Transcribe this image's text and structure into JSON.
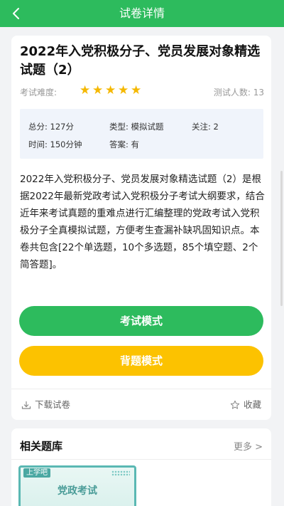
{
  "header": {
    "title": "试卷详情"
  },
  "paper": {
    "title": "2022年入党积极分子、党员发展对象精选试题（2）",
    "difficulty_label": "考试难度:",
    "difficulty_stars": 5,
    "testers": "测试人数: 13",
    "info": {
      "total": "总分: 127分",
      "type": "类型: 模拟试题",
      "follow": "关注: 2",
      "time": "时间: 150分钟",
      "answer": "答案: 有"
    },
    "description": "2022年入党积极分子、党员发展对象精选试题（2）是根据2022年最新党政考试入党积极分子考试大纲要求，结合近年来考试真题的重难点进行汇编整理的党政考试入党积极分子全真模拟试题，方便考生查漏补缺巩固知识点。本卷共包含[22个单选题，10个多选题，85个填空题、2个简答题]。"
  },
  "actions": {
    "exam_mode": "考试模式",
    "memorize_mode": "背题模式",
    "download": "下载试卷",
    "collect": "收藏"
  },
  "related": {
    "title": "相关题库",
    "more": "更多 >",
    "item": {
      "logo": "上学吧",
      "title": "党政考试"
    }
  },
  "colors": {
    "primary": "#2dbb5d",
    "secondary": "#fcc200",
    "star": "#f5b800"
  }
}
